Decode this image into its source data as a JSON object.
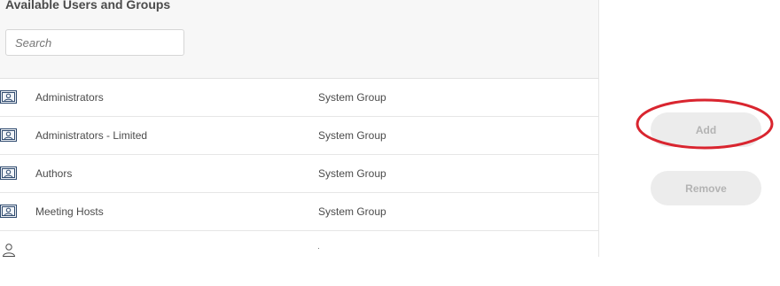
{
  "panel": {
    "title": "Available Users and Groups",
    "search": {
      "placeholder": "Search",
      "value": ""
    },
    "rows": [
      {
        "name": "Administrators",
        "type": "System Group",
        "icon": "group-icon"
      },
      {
        "name": "Administrators - Limited",
        "type": "System Group",
        "icon": "group-icon"
      },
      {
        "name": "Authors",
        "type": "System Group",
        "icon": "group-icon"
      },
      {
        "name": "Meeting Hosts",
        "type": "System Group",
        "icon": "group-icon"
      }
    ],
    "partial_row": {
      "icon": "user-icon"
    }
  },
  "actions": {
    "add_label": "Add",
    "remove_label": "Remove"
  },
  "annotation": {
    "color": "#d9252f",
    "shape": "ellipse",
    "target": "add-button"
  },
  "colors": {
    "header_bg": "#f7f7f7",
    "button_bg": "#ececec",
    "button_text_disabled": "#b3b3b3",
    "divider": "#e6e6e6"
  }
}
